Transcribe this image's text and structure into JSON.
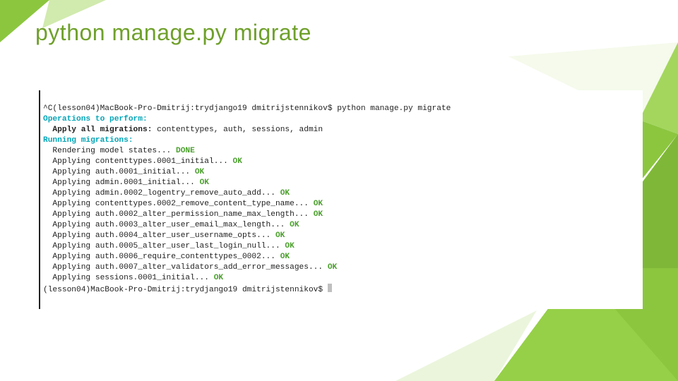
{
  "title": "python manage.py migrate",
  "terminal": {
    "line0_prefix": "^C(lesson04)MacBook-Pro-Dmitrij:trydjango19 dmitrijstennikov$ ",
    "line0_cmd": "python manage.py migrate",
    "line1": "Operations to perform:",
    "line2_bold": "  Apply all migrations:",
    "line2_rest": " contenttypes, auth, sessions, admin",
    "line3": "Running migrations:",
    "line4_text": "  Rendering model states... ",
    "line4_status": "DONE",
    "mig": [
      {
        "text": "  Applying contenttypes.0001_initial... ",
        "status": "OK"
      },
      {
        "text": "  Applying auth.0001_initial... ",
        "status": "OK"
      },
      {
        "text": "  Applying admin.0001_initial... ",
        "status": "OK"
      },
      {
        "text": "  Applying admin.0002_logentry_remove_auto_add... ",
        "status": "OK"
      },
      {
        "text": "  Applying contenttypes.0002_remove_content_type_name... ",
        "status": "OK"
      },
      {
        "text": "  Applying auth.0002_alter_permission_name_max_length... ",
        "status": "OK"
      },
      {
        "text": "  Applying auth.0003_alter_user_email_max_length... ",
        "status": "OK"
      },
      {
        "text": "  Applying auth.0004_alter_user_username_opts... ",
        "status": "OK"
      },
      {
        "text": "  Applying auth.0005_alter_user_last_login_null... ",
        "status": "OK"
      },
      {
        "text": "  Applying auth.0006_require_contenttypes_0002... ",
        "status": "OK"
      },
      {
        "text": "  Applying auth.0007_alter_validators_add_error_messages... ",
        "status": "OK"
      },
      {
        "text": "  Applying sessions.0001_initial... ",
        "status": "OK"
      }
    ],
    "line_last": "(lesson04)MacBook-Pro-Dmitrij:trydjango19 dmitrijstennikov$ "
  }
}
